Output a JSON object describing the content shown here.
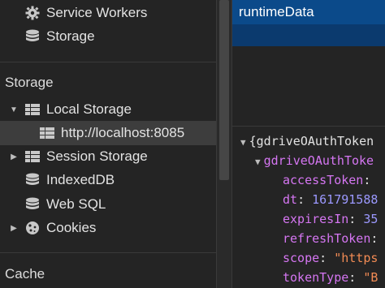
{
  "sidebar": {
    "app_items": [
      {
        "label": "Service Workers",
        "icon": "gear-icon"
      },
      {
        "label": "Storage",
        "icon": "database-icon"
      }
    ],
    "storage_header": "Storage",
    "storage_items": [
      {
        "label": "Local Storage",
        "icon": "grid-icon",
        "expanded": true
      },
      {
        "label": "http://localhost:8085",
        "icon": "grid-icon",
        "selected": true
      },
      {
        "label": "Session Storage",
        "icon": "grid-icon",
        "expanded": false
      },
      {
        "label": "IndexedDB",
        "icon": "database-icon"
      },
      {
        "label": "Web SQL",
        "icon": "database-icon"
      },
      {
        "label": "Cookies",
        "icon": "cookie-icon",
        "expanded": false
      }
    ],
    "cache_header": "Cache"
  },
  "key_list": {
    "selected_key": "runtimeData"
  },
  "json_preview": {
    "root_label": "{gdriveOAuthToken",
    "child_label": "gdriveOAuthToke",
    "fields": [
      {
        "key": "accessToken",
        "value": ""
      },
      {
        "key": "dt",
        "value": "161791588"
      },
      {
        "key": "expiresIn",
        "value": "35"
      },
      {
        "key": "refreshToken",
        "value": ""
      },
      {
        "key": "scope",
        "value": "\"https"
      },
      {
        "key": "tokenType",
        "value": "\"B"
      }
    ]
  },
  "colors": {
    "selected_key_bg": "#0b4a8a",
    "json_key": "#d576f2",
    "json_number": "#9c99ff",
    "json_string": "#f28b54"
  }
}
